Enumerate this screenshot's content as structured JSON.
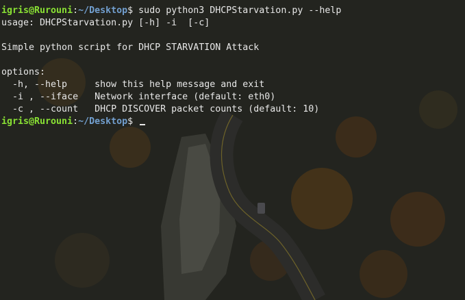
{
  "terminal": {
    "colors": {
      "user_host": "#8ae234",
      "path": "#729fcf",
      "text": "#e8e8e8"
    },
    "prompt": {
      "user_host": "igris@Rurouni",
      "colon": ":",
      "path": "~/Desktop",
      "symbol": "$"
    },
    "command": " sudo python3 DHCPStarvation.py --help",
    "output": [
      "usage: DHCPStarvation.py [-h] -i  [-c]",
      "",
      "Simple python script for DHCP STARVATION Attack",
      "",
      "options:",
      "  -h, --help     show this help message and exit",
      "  -i , --iface   Network interface (default: eth0)",
      "  -c , --count   DHCP DISCOVER packet counts (default: 10)"
    ],
    "current_input": " "
  }
}
